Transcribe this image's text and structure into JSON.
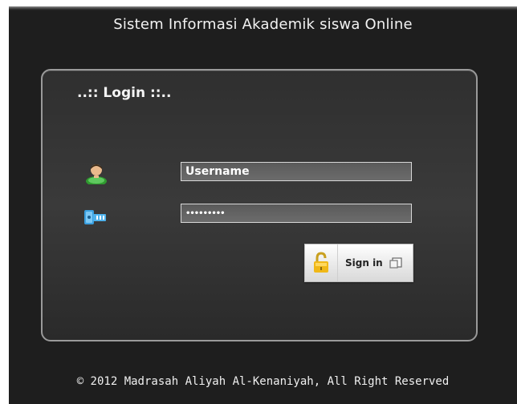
{
  "header": {
    "title": "Sistem Informasi Akademik siswa Online"
  },
  "login": {
    "heading": "..:: Login ::..",
    "username_value": "Username",
    "password_value": "•••••••••",
    "signin_label": "Sign in",
    "icons": {
      "username": "user-icon",
      "password": "key-icon",
      "signin_lock": "padlock-icon",
      "signin_arrow": "window-arrow-icon"
    }
  },
  "footer": {
    "copyright": "© 2012 Madrasah Aliyah Al-Kenaniyah, All Right Reserved"
  },
  "colors": {
    "background": "#1e1e1e",
    "panel_border": "#9a9a9a",
    "text": "#f2f2f2",
    "input_bg": "#5a5a5a",
    "button_bg": "#eeeeee"
  }
}
